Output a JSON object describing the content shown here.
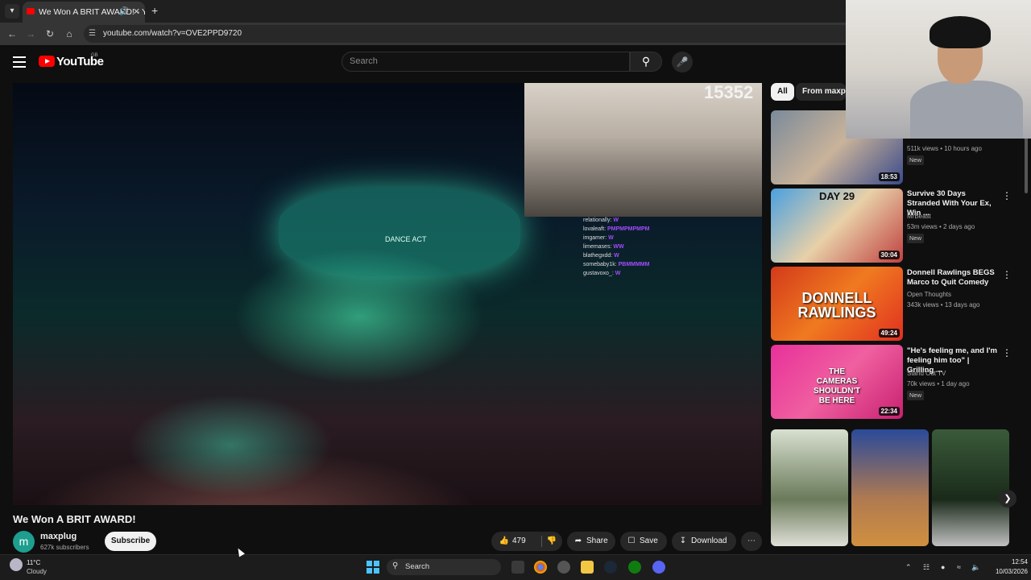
{
  "browser": {
    "tab_title": "We Won A BRIT AWARD! - YouTube",
    "url": "youtube.com/watch?v=OVE2PPD9720"
  },
  "header": {
    "logo_text": "YouTube",
    "country": "GB",
    "search_placeholder": "Search"
  },
  "video": {
    "viewer_count": "15352",
    "stage_text": "DANCE ACT",
    "chat": [
      {
        "user": "relationally",
        "msg": "W"
      },
      {
        "user": "lovaleaft",
        "msg": "PMPMPMPMPM"
      },
      {
        "user": "imgamer",
        "msg": "W"
      },
      {
        "user": "limemases",
        "msg": "WW"
      },
      {
        "user": "blathegxdd",
        "msg": "W"
      },
      {
        "user": "somebaby1k",
        "msg": "PBMMMMM"
      },
      {
        "user": "gustavoxo_",
        "msg": "W"
      }
    ],
    "title": "We Won A BRIT AWARD!"
  },
  "channel": {
    "avatar_letter": "m",
    "name": "maxplug",
    "subscribers": "627k subscribers",
    "subscribe_label": "Subscribe"
  },
  "actions": {
    "likes": "479",
    "share": "Share",
    "save": "Save",
    "download": "Download"
  },
  "sidebar": {
    "chips": [
      "All",
      "From maxplug"
    ],
    "videos": [
      {
        "title": "",
        "channel": "",
        "meta": "511k views • 10 hours ago",
        "badge": "New",
        "duration": "18:53",
        "thumb_text": ""
      },
      {
        "title": "Survive 30 Days Stranded With Your Ex, Win ...",
        "channel": "MrBeast",
        "meta": "53m views • 2 days ago",
        "badge": "New",
        "duration": "30:04",
        "thumb_text": "DAY 29"
      },
      {
        "title": "Donnell Rawlings BEGS Marco to Quit Comedy",
        "channel": "Open Thoughts",
        "meta": "343k views • 13 days ago",
        "badge": "",
        "duration": "49:24",
        "thumb_text": "DONNELL RAWLINGS"
      },
      {
        "title": "\"He's feeling me, and I'm feeling him too\" | Grilling ...",
        "channel": "Stand Out TV",
        "meta": "70k views • 1 day ago",
        "badge": "New",
        "duration": "22:34",
        "thumb_text": "THE CAMERAS SHOULDN'T BE HERE"
      }
    ]
  },
  "taskbar": {
    "temperature": "11°C",
    "condition": "Cloudy",
    "search": "Search",
    "time": "12:54",
    "date": "10/03/2026"
  },
  "colors": {
    "brand_red": "#ff0000",
    "background": "#0f0f0f",
    "chat_purple": "#a24cff"
  }
}
